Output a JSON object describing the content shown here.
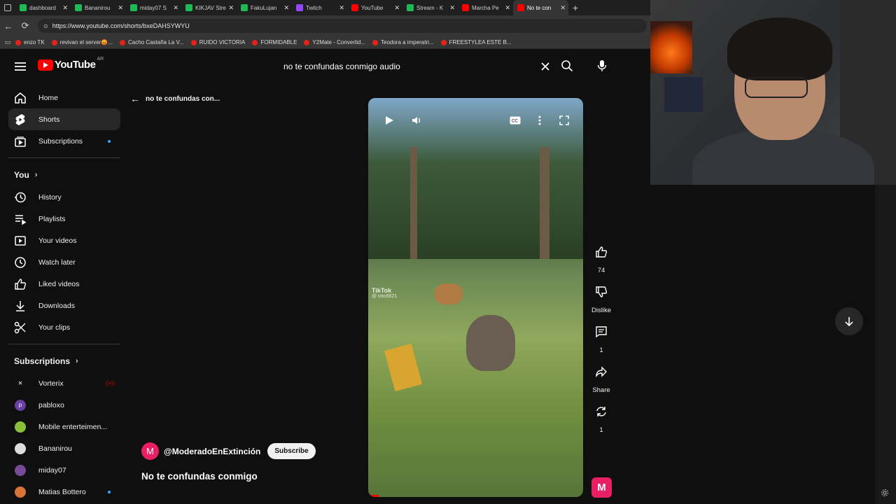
{
  "browser": {
    "tabs": [
      {
        "label": "dashboard",
        "color": "#1db954"
      },
      {
        "label": "Bananirou",
        "color": "#1db954"
      },
      {
        "label": "miday07 S",
        "color": "#1db954"
      },
      {
        "label": "KIKJAV Stre",
        "color": "#1db954"
      },
      {
        "label": "FakuLujan",
        "color": "#1db954"
      },
      {
        "label": "Twitch",
        "color": "#9146ff"
      },
      {
        "label": "YouTube",
        "color": "#ff0000"
      },
      {
        "label": "Stream - K",
        "color": "#1db954"
      },
      {
        "label": "Marcha Pe",
        "color": "#ff0000"
      },
      {
        "label": "No te con",
        "color": "#ff0000"
      }
    ],
    "url": "https://www.youtube.com/shorts/bxeDAHSYWYU",
    "bookmarks": [
      "enzo TK",
      "revivan el server😡...",
      "Cacho Castaña La V...",
      "RUIDO VICTORIA",
      "FORMIDABLE",
      "Y2Mate - Convertid...",
      "Teodora a imperatri...",
      "FREESTYLEA ESTE B..."
    ]
  },
  "header": {
    "logo_text": "YouTube",
    "country": "AR",
    "search_value": "no te confundas conmigo audio"
  },
  "sidebar": {
    "main": [
      {
        "label": "Home",
        "icon": "home-icon"
      },
      {
        "label": "Shorts",
        "icon": "shorts-icon"
      },
      {
        "label": "Subscriptions",
        "icon": "subscriptions-icon"
      }
    ],
    "you_title": "You",
    "you": [
      {
        "label": "History",
        "icon": "history-icon"
      },
      {
        "label": "Playlists",
        "icon": "playlists-icon"
      },
      {
        "label": "Your videos",
        "icon": "your-videos-icon"
      },
      {
        "label": "Watch later",
        "icon": "watch-later-icon"
      },
      {
        "label": "Liked videos",
        "icon": "liked-videos-icon"
      },
      {
        "label": "Downloads",
        "icon": "downloads-icon"
      },
      {
        "label": "Your clips",
        "icon": "clips-icon"
      }
    ],
    "subs_title": "Subscriptions",
    "subs": [
      {
        "label": "Vorterix",
        "color": "#111111",
        "initial": "✕"
      },
      {
        "label": "pabloxo",
        "color": "#6b3fa0",
        "initial": "p"
      },
      {
        "label": "Mobile enterteimen...",
        "color": "#8bbf3a",
        "initial": ""
      },
      {
        "label": "Bananirou",
        "color": "#dddddd",
        "initial": ""
      },
      {
        "label": "miday07",
        "color": "#7a4a9a",
        "initial": ""
      },
      {
        "label": "Matias Bottero",
        "color": "#d9733a",
        "initial": ""
      }
    ]
  },
  "shorts": {
    "back_label": "no te confundas con...",
    "overlay_text": "TikTok",
    "tiktok_user": "@ toto5621",
    "actions": {
      "like_count": "74",
      "dislike_label": "Dislike",
      "comment_count": "1",
      "share_label": "Share",
      "remix_count": "1"
    },
    "channel_name": "@ModeradoEnExtinción",
    "channel_initial": "M",
    "subscribe_label": "Subscribe",
    "title": "No te confundas conmigo",
    "progress": 0.05
  }
}
